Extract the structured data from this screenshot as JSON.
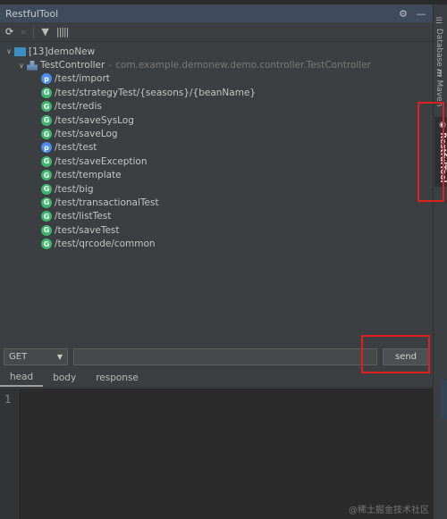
{
  "window": {
    "title": "RestfulTool",
    "settings_icon": "gear-icon",
    "minimize_icon": "minus-icon"
  },
  "toolbar": {
    "icons": [
      "refresh-icon",
      "search-icon",
      "filter-icon",
      "barcode-icon"
    ]
  },
  "tree": {
    "project": "[13]demoNew",
    "controller": {
      "name": "TestController",
      "separator": "-",
      "package": "com.example.demonew.demo.controller.TestController"
    },
    "endpoints": [
      {
        "method": "P",
        "path": "/test/import"
      },
      {
        "method": "G",
        "path": "/test/strategyTest/{seasons}/{beanName}"
      },
      {
        "method": "G",
        "path": "/test/redis"
      },
      {
        "method": "G",
        "path": "/test/saveSysLog"
      },
      {
        "method": "G",
        "path": "/test/saveLog"
      },
      {
        "method": "P",
        "path": "/test/test"
      },
      {
        "method": "G",
        "path": "/test/saveException"
      },
      {
        "method": "G",
        "path": "/test/template"
      },
      {
        "method": "G",
        "path": "/test/big"
      },
      {
        "method": "G",
        "path": "/test/transactionalTest"
      },
      {
        "method": "G",
        "path": "/test/listTest"
      },
      {
        "method": "G",
        "path": "/test/saveTest"
      },
      {
        "method": "G",
        "path": "/test/qrcode/common"
      }
    ]
  },
  "request": {
    "method": "GET",
    "url": "",
    "send_label": "send"
  },
  "tabs": [
    {
      "label": "head",
      "active": true
    },
    {
      "label": "body"
    },
    {
      "label": "response"
    }
  ],
  "editor": {
    "line_numbers": [
      "1"
    ]
  },
  "sidebar": {
    "items": [
      "Database",
      "Maven",
      "RestfulTool"
    ]
  },
  "watermark": "@稀土掘金技术社区",
  "colors": {
    "get_badge": "#3fb66e",
    "post_badge": "#4b8ef0",
    "highlight": "#e02020",
    "titlebar": "#3d4b5c"
  }
}
